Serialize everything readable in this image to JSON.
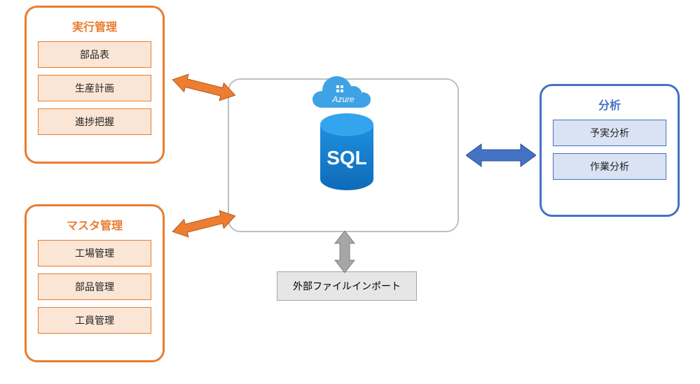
{
  "panels": {
    "execution": {
      "title": "実行管理",
      "items": [
        "部品表",
        "生産計画",
        "進捗把握"
      ]
    },
    "master": {
      "title": "マスタ管理",
      "items": [
        "工場管理",
        "部品管理",
        "工員管理"
      ]
    },
    "analysis": {
      "title": "分析",
      "items": [
        "予実分析",
        "作業分析"
      ]
    }
  },
  "center": {
    "cloud_label": "Azure",
    "db_label": "SQL"
  },
  "import_box": {
    "label": "外部ファイルインポート"
  },
  "colors": {
    "orange": "#e97c2f",
    "blue": "#4472c4",
    "grey": "#a6a6a6",
    "azure_blue": "#0078d4"
  }
}
